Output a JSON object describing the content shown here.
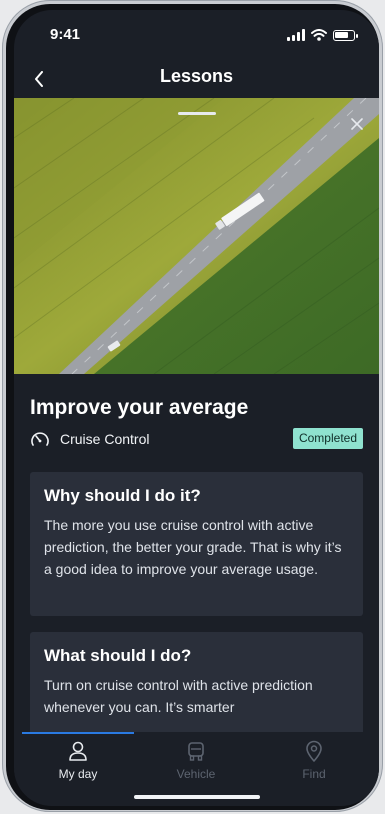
{
  "status_bar": {
    "time": "9:41"
  },
  "nav": {
    "title": "Lessons"
  },
  "lesson": {
    "title": "Improve your average",
    "category": "Cruise Control",
    "status": "Completed"
  },
  "cards": [
    {
      "heading": "Why should I do it?",
      "body": "The more you use cruise control with active prediction, the better your grade. That is why it’s a good idea to improve your average usage."
    },
    {
      "heading": "What should I do?",
      "body": "Turn on cruise control with active prediction whenever you can. It’s smarter"
    }
  ],
  "tabs": [
    {
      "label": "My day",
      "icon": "person-icon",
      "active": true
    },
    {
      "label": "Vehicle",
      "icon": "truck-front-icon",
      "active": false
    },
    {
      "label": "Find",
      "icon": "map-pin-icon",
      "active": false
    }
  ],
  "colors": {
    "background": "#1b1f27",
    "card": "#2a2f3a",
    "badge": "#8fe2cf",
    "tab_indicator": "#2a7ae2"
  }
}
